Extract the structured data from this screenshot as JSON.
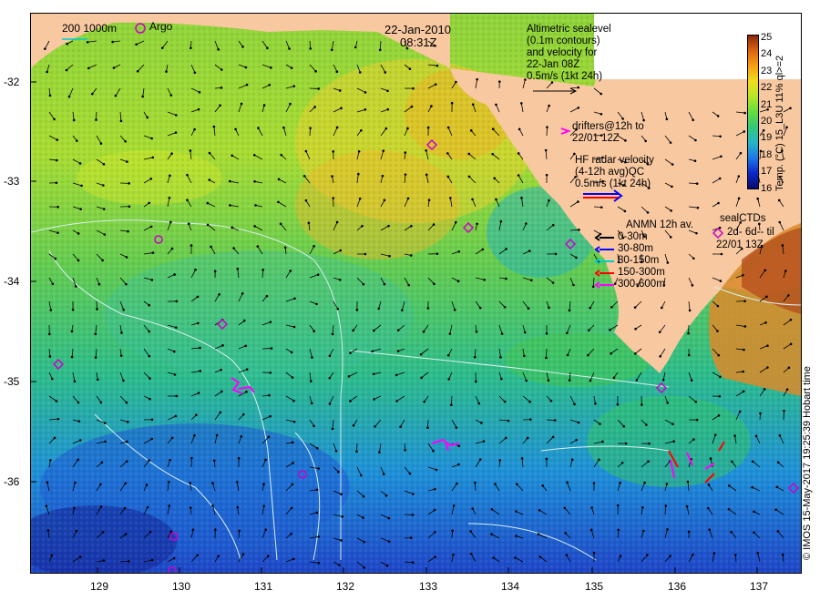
{
  "header": {
    "date": "22-Jan-2010",
    "time": "08:31Z"
  },
  "legend": {
    "contour_label": "200  1000m",
    "argo_label": "Argo",
    "altimetric": [
      "Altimetric sealevel",
      "(0.1m contours)",
      "and velocity for",
      "22-Jan 08Z",
      "0.5m/s (1kt 24h)"
    ],
    "drifters": [
      "drifters@12h to",
      "22/01 12Z"
    ],
    "hf_radar": [
      "HF radar velocity",
      "(4-12h avg)QC",
      "0.5m/s (1kt 24h)"
    ],
    "anmn_title": "ANMN 12h av.",
    "anmn_items": [
      {
        "label": "0-30m",
        "color": "#000000"
      },
      {
        "label": "30-80m",
        "color": "#0000ff"
      },
      {
        "label": "80-150m",
        "color": "#00cccc"
      },
      {
        "label": "150-300m",
        "color": "#ff0000"
      },
      {
        "label": "300-600m",
        "color": "#ff00ff"
      }
    ],
    "sealctd": [
      "sealCTDs",
      "2d-  6d-- til",
      "22/01 13Z"
    ]
  },
  "colorbar": {
    "title": "Temp. (°C) 15_L3U 11% ql>=2",
    "ticks": [
      "25",
      "24",
      "23",
      "22",
      "21",
      "20",
      "19",
      "18",
      "17",
      "16"
    ],
    "range": [
      16,
      25
    ],
    "colors": [
      "#0a0a6e",
      "#0a28c8",
      "#1e78e6",
      "#28b4c8",
      "#32c878",
      "#64dc3c",
      "#b4e628",
      "#f0dc1e",
      "#f5a014",
      "#dc6414",
      "#8c280a"
    ]
  },
  "axes": {
    "x_ticks": [
      "129",
      "130",
      "131",
      "132",
      "133",
      "134",
      "135",
      "136",
      "137"
    ],
    "y_ticks": [
      "-32",
      "-33",
      "-34",
      "-35",
      "-36"
    ]
  },
  "credit": "© IMOS 15-May-2017 19:25:39 Hobart time",
  "colors": {
    "land": "#f8c8a0",
    "argo": "#cc00cc",
    "contour": "#d8f0f0"
  },
  "icons": {
    "argo": "circle-marker",
    "sealctd": "diamond-marker"
  }
}
